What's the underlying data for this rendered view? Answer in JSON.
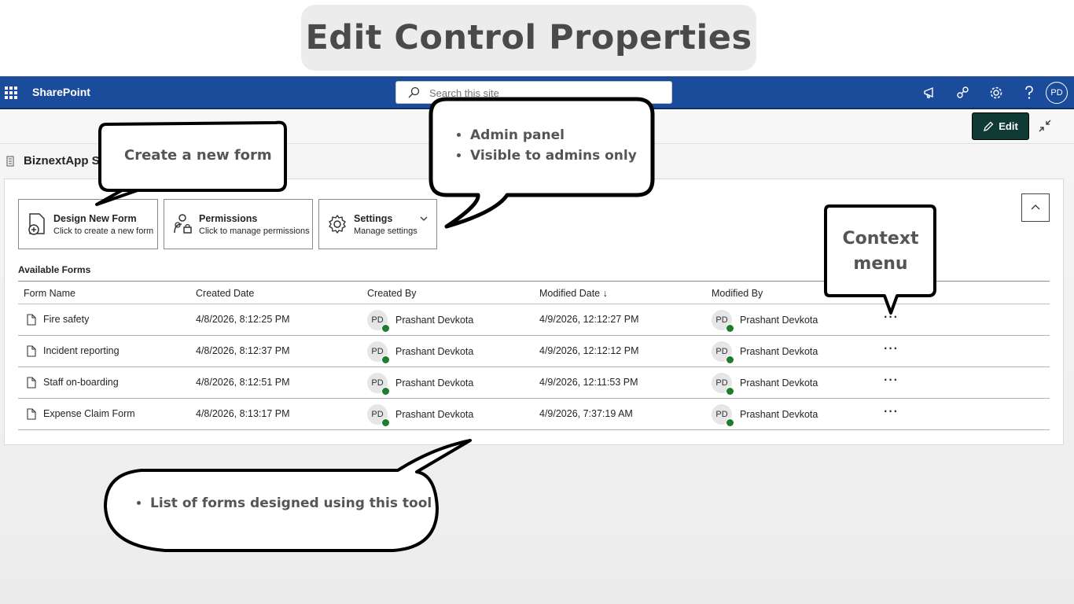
{
  "banner": {
    "title": "Edit Control Properties"
  },
  "suitebar": {
    "app_name": "SharePoint",
    "search_placeholder": "Search this site",
    "avatar_initials": "PD",
    "icons": [
      "megaphone-icon",
      "share-icon",
      "gear-icon",
      "help-icon"
    ]
  },
  "commandbar": {
    "edit_label": "Edit"
  },
  "page": {
    "title": "BiznextApp Sh"
  },
  "actions": [
    {
      "title": "Design New Form",
      "subtitle": "Click to create a new form"
    },
    {
      "title": "Permissions",
      "subtitle": "Click to manage permissions"
    },
    {
      "title": "Settings",
      "subtitle": "Manage settings"
    }
  ],
  "forms_table": {
    "label": "Available Forms",
    "columns": [
      "Form Name",
      "Created Date",
      "Created By",
      "Modified Date ↓",
      "Modified By"
    ],
    "rows": [
      {
        "name": "Fire safety",
        "created": "4/8/2026, 8:12:25 PM",
        "created_by": "Prashant Devkota",
        "created_by_initials": "PD",
        "modified": "4/9/2026, 12:12:27 PM",
        "modified_by": "Prashant Devkota",
        "modified_by_initials": "PD"
      },
      {
        "name": "Incident reporting",
        "created": "4/8/2026, 8:12:37 PM",
        "created_by": "Prashant Devkota",
        "created_by_initials": "PD",
        "modified": "4/9/2026, 12:12:12 PM",
        "modified_by": "Prashant Devkota",
        "modified_by_initials": "PD"
      },
      {
        "name": "Staff on-boarding",
        "created": "4/8/2026, 8:12:51 PM",
        "created_by": "Prashant Devkota",
        "created_by_initials": "PD",
        "modified": "4/9/2026, 12:11:53 PM",
        "modified_by": "Prashant Devkota",
        "modified_by_initials": "PD"
      },
      {
        "name": "Expense Claim Form",
        "created": "4/8/2026, 8:13:17 PM",
        "created_by": "Prashant Devkota",
        "created_by_initials": "PD",
        "modified": "4/9/2026, 7:37:19 AM",
        "modified_by": "Prashant Devkota",
        "modified_by_initials": "PD"
      }
    ],
    "more_label": "···"
  },
  "callouts": {
    "create": "Create a new form",
    "admin": [
      "Admin panel",
      "Visible to admins only"
    ],
    "context": [
      "Context",
      "menu"
    ],
    "list": "List of forms designed using this tool"
  },
  "colors": {
    "suitebar": "#1b4b9b",
    "edit_button": "#0f3b34",
    "presence": "#1d7d2a"
  }
}
